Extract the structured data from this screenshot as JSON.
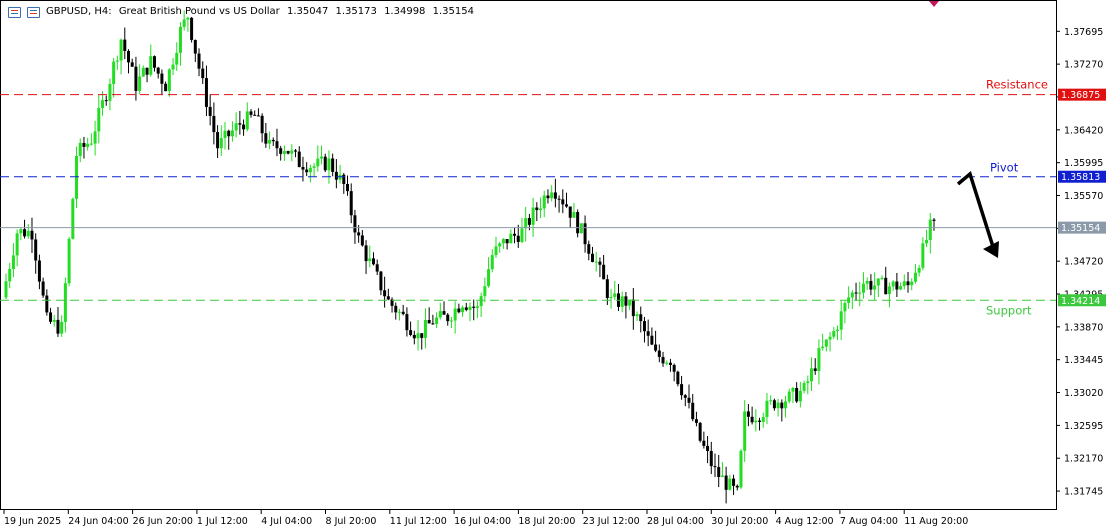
{
  "header": {
    "symbol": "GBPUSD, H4:",
    "description": "Great British Pound vs US Dollar",
    "open": "1.35047",
    "high": "1.35173",
    "low": "1.34998",
    "close": "1.35154"
  },
  "chart_data": {
    "type": "candlestick",
    "symbol": "GBPUSD",
    "timeframe": "H4",
    "ylim": [
      1.315,
      1.381
    ],
    "y_ticks": [
      "1.37695",
      "1.37270",
      "1.36845",
      "1.36420",
      "1.35995",
      "1.35570",
      "1.35145",
      "1.34720",
      "1.34295",
      "1.33870",
      "1.33445",
      "1.33020",
      "1.32595",
      "1.32170",
      "1.31745"
    ],
    "x_ticks": [
      "19 Jun 2025",
      "24 Jun 04:00",
      "26 Jun 20:00",
      "1 Jul 12:00",
      "4 Jul 04:00",
      "8 Jul 20:00",
      "11 Jul 12:00",
      "16 Jul 04:00",
      "18 Jul 20:00",
      "23 Jul 12:00",
      "28 Jul 04:00",
      "30 Jul 20:00",
      "4 Aug 12:00",
      "7 Aug 04:00",
      "11 Aug 20:00"
    ],
    "levels": [
      {
        "label": "Resistance",
        "value": 1.36875,
        "value_label": "1.36875",
        "color": "#e01010"
      },
      {
        "label": "Pivot",
        "value": 1.35813,
        "value_label": "1.35813",
        "color": "#1020d0"
      },
      {
        "label": "Support",
        "value": 1.34214,
        "value_label": "1.34214",
        "color": "#3cc83c"
      }
    ],
    "current_price": {
      "value": 1.35154,
      "value_label": "1.35154",
      "color": "#8a9aa8"
    },
    "colors": {
      "bull": "#22dd22",
      "bear": "#000000",
      "grid": "#c8c8c8",
      "text": "#000000"
    },
    "annotation": "arrow pointing down from pivot level",
    "path_points": [
      [
        0,
        1.3425
      ],
      [
        4,
        1.351
      ],
      [
        8,
        1.351
      ],
      [
        12,
        1.3395
      ],
      [
        16,
        1.3385
      ],
      [
        20,
        1.361
      ],
      [
        24,
        1.363
      ],
      [
        28,
        1.369
      ],
      [
        32,
        1.376
      ],
      [
        36,
        1.37
      ],
      [
        40,
        1.373
      ],
      [
        44,
        1.37
      ],
      [
        48,
        1.377
      ],
      [
        50,
        1.379
      ],
      [
        54,
        1.37
      ],
      [
        58,
        1.362
      ],
      [
        64,
        1.365
      ],
      [
        68,
        1.366
      ],
      [
        72,
        1.362
      ],
      [
        76,
        1.362
      ],
      [
        80,
        1.36
      ],
      [
        84,
        1.3595
      ],
      [
        88,
        1.36
      ],
      [
        92,
        1.357
      ],
      [
        96,
        1.35
      ],
      [
        100,
        1.346
      ],
      [
        104,
        1.342
      ],
      [
        108,
        1.34
      ],
      [
        112,
        1.3375
      ],
      [
        116,
        1.3395
      ],
      [
        120,
        1.34
      ],
      [
        124,
        1.342
      ],
      [
        128,
        1.341
      ],
      [
        132,
        1.348
      ],
      [
        136,
        1.35
      ],
      [
        140,
        1.351
      ],
      [
        144,
        1.354
      ],
      [
        148,
        1.357
      ],
      [
        152,
        1.3545
      ],
      [
        156,
        1.351
      ],
      [
        160,
        1.347
      ],
      [
        164,
        1.342
      ],
      [
        168,
        1.342
      ],
      [
        172,
        1.339
      ],
      [
        176,
        1.335
      ],
      [
        180,
        1.3345
      ],
      [
        184,
        1.3295
      ],
      [
        188,
        1.324
      ],
      [
        192,
        1.32
      ],
      [
        196,
        1.318
      ],
      [
        198,
        1.317
      ],
      [
        200,
        1.327
      ],
      [
        204,
        1.3275
      ],
      [
        208,
        1.329
      ],
      [
        212,
        1.3295
      ],
      [
        216,
        1.3305
      ],
      [
        220,
        1.335
      ],
      [
        224,
        1.338
      ],
      [
        228,
        1.3425
      ],
      [
        232,
        1.3445
      ],
      [
        236,
        1.344
      ],
      [
        240,
        1.344
      ],
      [
        244,
        1.344
      ],
      [
        248,
        1.3485
      ],
      [
        250,
        1.3515
      ]
    ]
  }
}
